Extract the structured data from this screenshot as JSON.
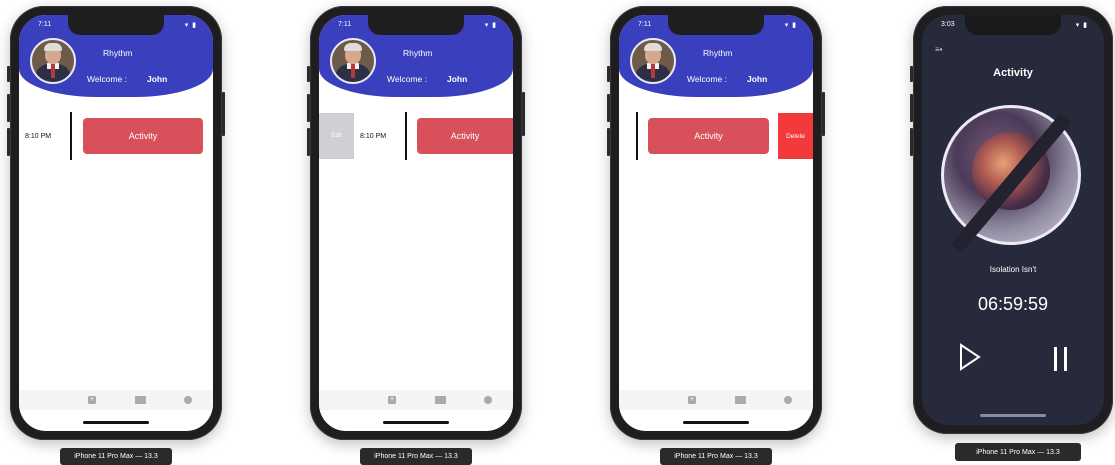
{
  "device_label": "iPhone 11 Pro Max — 13.3",
  "phones": [
    {
      "status_time": "7:11",
      "app_title": "Rhythm",
      "welcome_label": "Welcome :",
      "user_name": "John",
      "row_time": "8:10 PM",
      "activity_label": "Activity"
    },
    {
      "status_time": "7:11",
      "app_title": "Rhythm",
      "welcome_label": "Welcome :",
      "user_name": "John",
      "row_time": "8:10 PM",
      "activity_label": "Activity",
      "swipe_action": "Edit"
    },
    {
      "status_time": "7:11",
      "app_title": "Rhythm",
      "welcome_label": "Welcome :",
      "user_name": "John",
      "activity_label": "Activity",
      "swipe_action": "Delete"
    }
  ],
  "player": {
    "status_time": "3:03",
    "title": "Activity",
    "track_name": "Isolation Isn't",
    "timer": "06:59:59"
  },
  "icons": [
    "menu-icon",
    "add-icon",
    "folder-icon",
    "profile-icon",
    "play-icon",
    "pause-icon",
    "wifi-icon",
    "battery-icon"
  ],
  "colors": {
    "header": "#3a3fbd",
    "activity_button": "#d8515a",
    "delete_action": "#f33a3a",
    "edit_action": "#cfcfd4",
    "player_background": "#262a3b"
  }
}
